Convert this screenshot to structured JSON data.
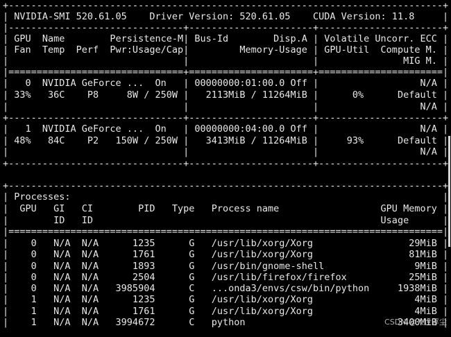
{
  "terminal": {
    "text_color": "#e8e8e8",
    "background": "#000000",
    "lines": [
      "+-----------------------------------------------------------------------------+",
      "| NVIDIA-SMI 520.61.05    Driver Version: 520.61.05    CUDA Version: 11.8     |",
      "|-------------------------------+----------------------+----------------------+",
      "| GPU  Name        Persistence-M| Bus-Id        Disp.A | Volatile Uncorr. ECC |",
      "| Fan  Temp  Perf  Pwr:Usage/Cap|         Memory-Usage | GPU-Util  Compute M. |",
      "|                               |                      |               MIG M. |",
      "|===============================+======================+======================|",
      "|   0  NVIDIA GeForce ...  On   | 00000000:01:00.0 Off |                  N/A |",
      "| 33%   36C    P8     8W / 250W |   2113MiB / 11264MiB |      0%      Default |",
      "|                               |                      |                  N/A |",
      "+-------------------------------+----------------------+----------------------+",
      "|   1  NVIDIA GeForce ...  On   | 00000000:04:00.0 Off |                  N/A |",
      "| 48%   84C    P2   150W / 250W |   3413MiB / 11264MiB |     93%      Default |",
      "|                               |                      |                  N/A |",
      "+-------------------------------+----------------------+----------------------+",
      "",
      "+-----------------------------------------------------------------------------+",
      "| Processes:                                                                  |",
      "|  GPU   GI   CI        PID   Type   Process name                  GPU Memory |",
      "|        ID   ID                                                   Usage      |",
      "|=============================================================================|",
      "|    0   N/A  N/A      1235      G   /usr/lib/xorg/Xorg                 29MiB |",
      "|    0   N/A  N/A      1761      G   /usr/lib/xorg/Xorg                 81MiB |",
      "|    0   N/A  N/A      1893      G   /usr/bin/gnome-shell                9MiB |",
      "|    0   N/A  N/A      2504      G   /usr/lib/firefox/firefox           25MiB |",
      "|    0   N/A  N/A   3985904      C   ...onda3/envs/csw/bin/python     1938MiB |",
      "|    1   N/A  N/A      1235      G   /usr/lib/xorg/Xorg                  4MiB |",
      "|    1   N/A  N/A      1761      G   /usr/lib/xorg/Xorg                  4MiB |",
      "|    1   N/A  N/A   3994672      C   python                           3400MiB |"
    ]
  },
  "watermark": {
    "text": "CSDN @入世浮尘"
  }
}
